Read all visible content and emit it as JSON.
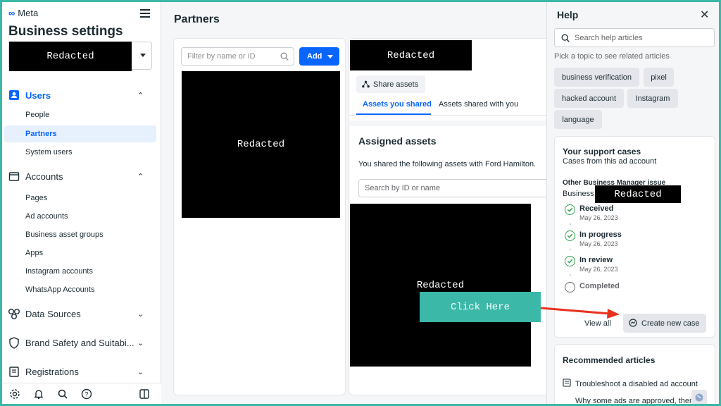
{
  "sidebar": {
    "logo_text": "Meta",
    "title": "Business settings",
    "account_redacted": "Redacted",
    "sections": [
      {
        "label": "Users",
        "icon": "users-icon",
        "expanded": true
      },
      {
        "label": "Accounts",
        "icon": "accounts-icon",
        "expanded": true
      },
      {
        "label": "Data Sources",
        "icon": "data-sources-icon",
        "expanded": false
      },
      {
        "label": "Brand Safety and Suitabi...",
        "icon": "shield-icon",
        "expanded": false
      },
      {
        "label": "Registrations",
        "icon": "registrations-icon",
        "expanded": false
      }
    ],
    "users_items": [
      "People",
      "Partners",
      "System users"
    ],
    "accounts_items": [
      "Pages",
      "Ad accounts",
      "Business asset groups",
      "Apps",
      "Instagram accounts",
      "WhatsApp Accounts"
    ],
    "selected_item": "Partners",
    "footer_icons": [
      "gear-icon",
      "bell-icon",
      "search-icon",
      "help-icon",
      "panel-icon"
    ]
  },
  "main": {
    "title": "Partners",
    "filter_placeholder": "Filter by name or ID",
    "add_label": "Add",
    "partner_list_redacted": "Redacted",
    "partner_name_redacted": "Redacted",
    "share_assets_label": "Share assets",
    "tabs": [
      "Assets you shared",
      "Assets shared with you"
    ],
    "active_tab": "Assets you shared",
    "assigned_title": "Assigned assets",
    "assigned_sub": "You shared the following assets with Ford Hamilton.",
    "search_placeholder": "Search by ID or name",
    "assets_redacted": "Redacted"
  },
  "help": {
    "title": "Help",
    "search_placeholder": "Search help articles",
    "pick_topic": "Pick a topic to see related articles",
    "chips": [
      "business verification",
      "pixel",
      "hacked account",
      "Instagram",
      "language"
    ],
    "support": {
      "title": "Your support cases",
      "subtitle": "Cases from this ad account",
      "case_title": "Other Business Manager issue",
      "case_business": "Business",
      "case_redacted": "Redacted",
      "steps": [
        {
          "label": "Received",
          "date": "May 26, 2023",
          "done": true
        },
        {
          "label": "In progress",
          "date": "May 26, 2023",
          "done": true
        },
        {
          "label": "In review",
          "date": "May 26, 2023",
          "done": true
        },
        {
          "label": "Completed",
          "date": "",
          "done": false
        }
      ],
      "view_all": "View all",
      "create_case": "Create new case"
    },
    "recommended": {
      "title": "Recommended articles",
      "items": [
        "Troubleshoot a disabled ad account",
        "Why some ads are approved, then"
      ]
    }
  },
  "annotation": {
    "click_here": "Click Here",
    "bg_color": "#3bb8a8",
    "arrow_color": "#e8321e"
  },
  "colors": {
    "accent": "#0866ff",
    "success": "#31a24c"
  }
}
